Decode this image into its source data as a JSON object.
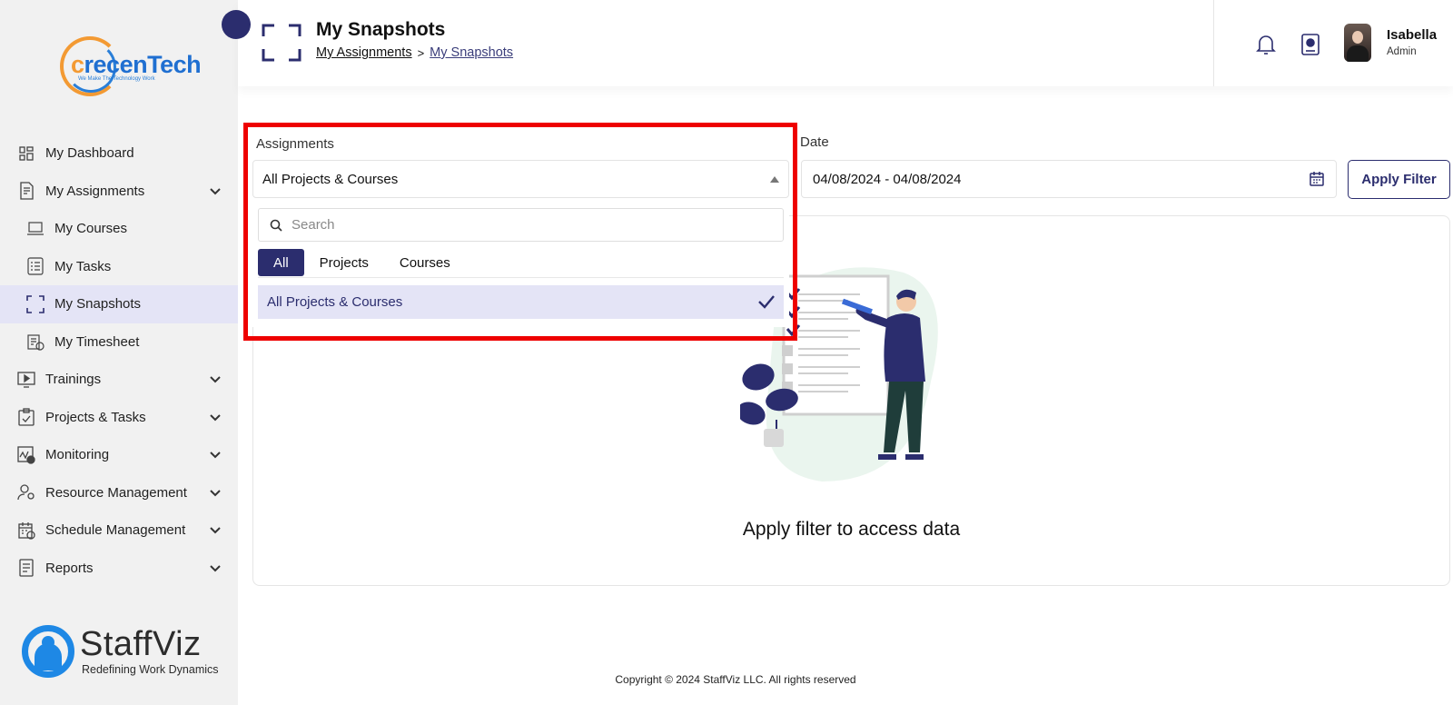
{
  "app": {
    "logo_top_brand": "recenTech",
    "logo_top_initial": "c",
    "logo_top_tagline": "We Make The Technology Work",
    "logo_bottom_name": "StaffViz",
    "logo_bottom_tagline": "Redefining Work Dynamics"
  },
  "sidebar": {
    "items": [
      {
        "label": "My Dashboard",
        "icon": "dashboard-icon",
        "expandable": false,
        "sub": false,
        "active": false
      },
      {
        "label": "My Assignments",
        "icon": "assignments-icon",
        "expandable": true,
        "sub": false,
        "active": false
      },
      {
        "label": "My Courses",
        "icon": "courses-icon",
        "expandable": false,
        "sub": true,
        "active": false
      },
      {
        "label": "My Tasks",
        "icon": "tasks-icon",
        "expandable": false,
        "sub": true,
        "active": false
      },
      {
        "label": "My Snapshots",
        "icon": "snapshots-icon",
        "expandable": false,
        "sub": true,
        "active": true
      },
      {
        "label": "My Timesheet",
        "icon": "timesheet-icon",
        "expandable": false,
        "sub": true,
        "active": false
      },
      {
        "label": "Trainings",
        "icon": "trainings-icon",
        "expandable": true,
        "sub": false,
        "active": false
      },
      {
        "label": "Projects & Tasks",
        "icon": "clipboard-icon",
        "expandable": true,
        "sub": false,
        "active": false
      },
      {
        "label": "Monitoring",
        "icon": "monitoring-icon",
        "expandable": true,
        "sub": false,
        "active": false
      },
      {
        "label": "Resource Management",
        "icon": "resource-icon",
        "expandable": true,
        "sub": false,
        "active": false
      },
      {
        "label": "Schedule Management",
        "icon": "schedule-icon",
        "expandable": true,
        "sub": false,
        "active": false
      },
      {
        "label": "Reports",
        "icon": "reports-icon",
        "expandable": true,
        "sub": false,
        "active": false
      }
    ]
  },
  "header": {
    "title": "My Snapshots",
    "breadcrumb": {
      "parent": "My Assignments",
      "separator": ">",
      "current": "My Snapshots"
    },
    "user": {
      "name": "Isabella",
      "role": "Admin"
    }
  },
  "filters": {
    "assignments_label": "Assignments",
    "assignments_value": "All Projects & Courses",
    "date_label": "Date",
    "date_value": "04/08/2024 - 04/08/2024",
    "apply_label": "Apply Filter"
  },
  "dropdown": {
    "search_placeholder": "Search",
    "tabs": [
      "All",
      "Projects",
      "Courses"
    ],
    "active_tab": "All",
    "options": [
      {
        "label": "All Projects & Courses",
        "selected": true
      }
    ]
  },
  "content": {
    "empty_message": "Apply filter to access data"
  },
  "footer": {
    "copyright": "Copyright © 2024 StaffViz LLC. All rights reserved"
  },
  "colors": {
    "primary": "#2b2d6e",
    "highlight": "#ee0000",
    "active_bg": "#e4e4f6",
    "sidebar_bg": "#f1f1f1"
  }
}
